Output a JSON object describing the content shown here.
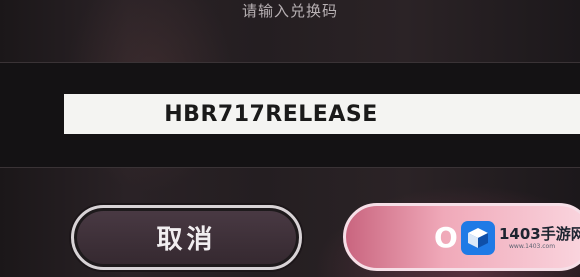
{
  "dialog": {
    "prompt": "请输入兑换码",
    "code_value": "HBR717RELEASE",
    "cancel_label": "取消",
    "confirm_label": "O"
  },
  "watermark": {
    "name": "1403手游网",
    "url": "www.1403.com",
    "icon": "cube-logo-icon"
  },
  "colors": {
    "background": "#241e21",
    "panel": "#141214",
    "field": "#f4f4f2",
    "cancel_fill": "#3d3038",
    "confirm_fill": "#f0a9b9",
    "logo_blue": "#1f7ae6"
  }
}
